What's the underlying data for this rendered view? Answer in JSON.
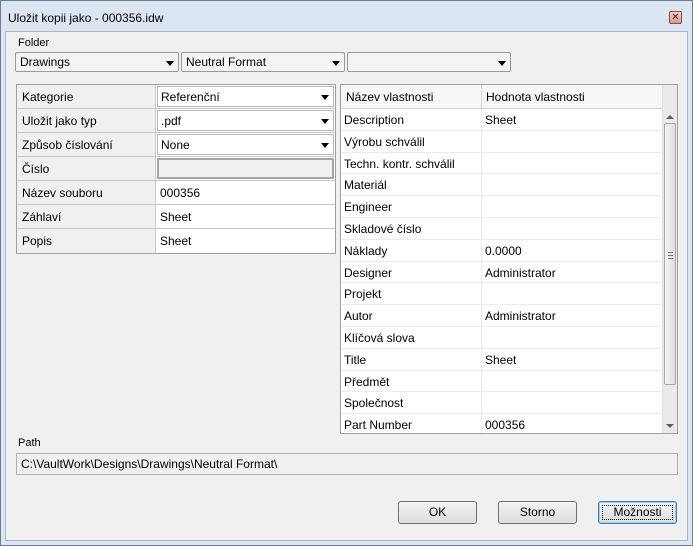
{
  "window": {
    "title": "Uložit kopii jako - 000356.idw"
  },
  "folder": {
    "label": "Folder",
    "combo1": "Drawings",
    "combo2": "Neutral Format",
    "combo3": ""
  },
  "left_grid": {
    "rows": [
      {
        "key": "Kategorie",
        "value": "Referenční",
        "type": "combo"
      },
      {
        "key": "Uložit jako typ",
        "value": ".pdf",
        "type": "combo"
      },
      {
        "key": "Způsob číslování",
        "value": "None",
        "type": "combo"
      },
      {
        "key": "Číslo",
        "value": "",
        "type": "empty"
      },
      {
        "key": "Název souboru",
        "value": "000356",
        "type": "text"
      },
      {
        "key": "Záhlaví",
        "value": "Sheet",
        "type": "text"
      },
      {
        "key": "Popis",
        "value": "Sheet",
        "type": "text"
      }
    ]
  },
  "right_grid": {
    "col_name": "Název vlastnosti",
    "col_value": "Hodnota vlastnosti",
    "rows": [
      {
        "name": "Description",
        "value": "Sheet"
      },
      {
        "name": "Výrobu schválil",
        "value": ""
      },
      {
        "name": "Techn. kontr. schválil",
        "value": ""
      },
      {
        "name": "Materiál",
        "value": ""
      },
      {
        "name": "Engineer",
        "value": ""
      },
      {
        "name": "Skladové číslo",
        "value": ""
      },
      {
        "name": "Náklady",
        "value": "0.0000"
      },
      {
        "name": "Designer",
        "value": "Administrator"
      },
      {
        "name": "Projekt",
        "value": ""
      },
      {
        "name": "Autor",
        "value": "Administrator"
      },
      {
        "name": "Klíčová slova",
        "value": ""
      },
      {
        "name": "Title",
        "value": "Sheet"
      },
      {
        "name": "Předmět",
        "value": ""
      },
      {
        "name": "Společnost",
        "value": ""
      },
      {
        "name": "Part Number",
        "value": "000356"
      }
    ]
  },
  "path": {
    "label": "Path",
    "value": "C:\\VaultWork\\Designs\\Drawings\\Neutral Format\\"
  },
  "buttons": {
    "ok": "OK",
    "cancel": "Storno",
    "options": "Možnosti"
  }
}
